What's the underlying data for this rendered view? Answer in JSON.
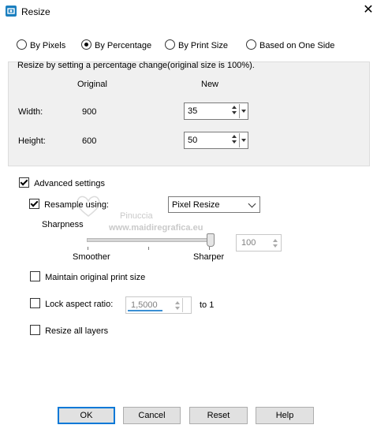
{
  "window": {
    "title": "Resize",
    "close_glyph": "✕"
  },
  "modes": [
    {
      "label": "By Pixels",
      "selected": false
    },
    {
      "label": "By Percentage",
      "selected": true
    },
    {
      "label": "By Print Size",
      "selected": false
    },
    {
      "label": "Based on One Side",
      "selected": false
    }
  ],
  "percent_group": {
    "caption": "Resize by setting a percentage change(original size is 100%).",
    "col_original": "Original",
    "col_new": "New",
    "width_label": "Width:",
    "width_original": "900",
    "width_new": "35",
    "height_label": "Height:",
    "height_original": "600",
    "height_new": "50"
  },
  "advanced": {
    "label": "Advanced settings",
    "checked": true,
    "resample_label": "Resample using:",
    "resample_checked": true,
    "resample_value": "Pixel Resize",
    "sharpness_label": "Sharpness",
    "smoother_label": "Smoother",
    "sharper_label": "Sharper",
    "sharpness_value": "100",
    "maintain_label": "Maintain original print size",
    "lock_label": "Lock aspect ratio:",
    "ratio_value": "1,5000",
    "ratio_suffix": "to 1",
    "resize_layers_label": "Resize all layers"
  },
  "watermark": {
    "line1": "Pinuccia",
    "line2": "www.maidiregrafica.eu"
  },
  "buttons": {
    "ok": "OK",
    "cancel": "Cancel",
    "reset": "Reset",
    "help": "Help"
  },
  "colors": {
    "accent": "#0078d7",
    "icon": "#1b7fbf"
  }
}
